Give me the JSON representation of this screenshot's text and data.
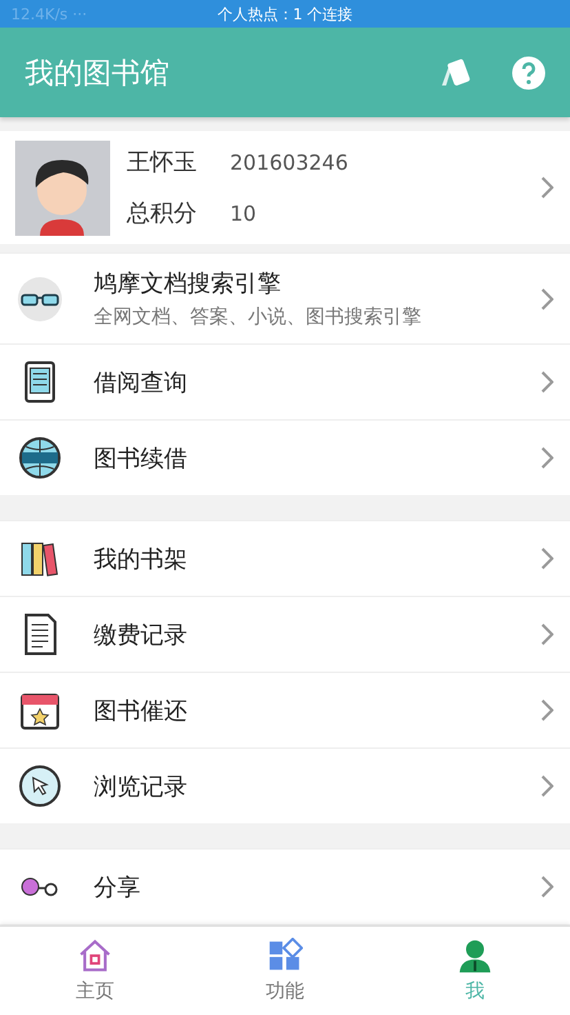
{
  "status_bar": {
    "speed": "12.4K/s ···",
    "hotspot": "个人热点：1 个连接"
  },
  "header": {
    "title": "我的图书馆"
  },
  "profile": {
    "name": "王怀玉",
    "id": "201603246",
    "points_label": "总积分",
    "points": "10"
  },
  "groups": [
    {
      "items": [
        {
          "title": "鸠摩文档搜索引擎",
          "subtitle": "全网文档、答案、小说、图书搜索引擎"
        },
        {
          "title": "借阅查询"
        },
        {
          "title": "图书续借"
        }
      ]
    },
    {
      "items": [
        {
          "title": "我的书架"
        },
        {
          "title": "缴费记录"
        },
        {
          "title": "图书催还"
        },
        {
          "title": "浏览记录"
        }
      ]
    },
    {
      "items": [
        {
          "title": "分享"
        }
      ]
    }
  ],
  "tabs": [
    {
      "label": "主页",
      "selected": false
    },
    {
      "label": "功能",
      "selected": false
    },
    {
      "label": "我",
      "selected": true
    }
  ]
}
